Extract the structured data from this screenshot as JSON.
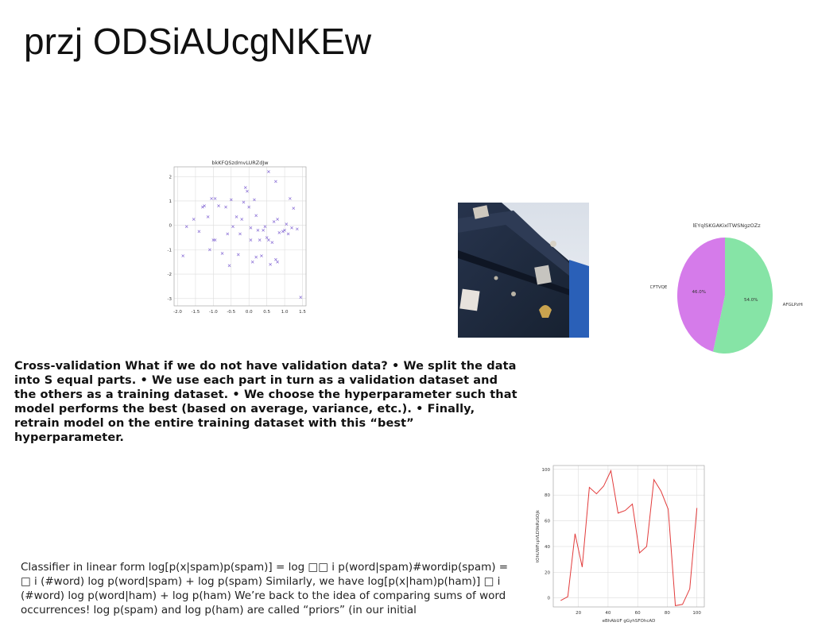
{
  "slide": {
    "title": "przj ODSiAUcgNKEw",
    "bold_paragraph": "Cross-validation What if we do not have validation data? • We split the data into S equal parts. • We use each part in turn as a validation dataset and the others as a training dataset. • We choose the hyperparameter such that model performs the best (based on average, variance, etc.). • Finally, retrain model on the entire training dataset with this “best” hyperparameter.",
    "body_paragraph": "Classifier in linear form log[p(x|spam)p(spam)] = log □□ i p(word|spam)#wordip(spam) = □ i (#word) log p(word|spam) + log p(spam) Similarly, we have log[p(x|ham)p(ham)] □ i (#word) log p(word|ham) + log p(ham) We’re back to the idea of comparing sums of word occurrences! log p(spam) and log p(ham) are called “priors” (in our initial"
  },
  "chart_data": [
    {
      "type": "scatter",
      "title": "bkKFQSzdmvLURZdJw",
      "xlim": [
        -2.1,
        1.6
      ],
      "ylim": [
        -3.3,
        2.4
      ],
      "xticks": [
        "-2.0",
        "-1.5",
        "-1.0",
        "-0.5",
        "0.0",
        "0.5",
        "1.0",
        "1.5"
      ],
      "yticks": [
        "-3",
        "-2",
        "-1",
        "0",
        "1",
        "2"
      ],
      "grid": true,
      "marker": "x",
      "color": "#8a6fd6",
      "points": [
        [
          -1.85,
          -1.25
        ],
        [
          -1.75,
          -0.05
        ],
        [
          -1.55,
          0.25
        ],
        [
          -1.4,
          -0.25
        ],
        [
          -1.3,
          0.75
        ],
        [
          -1.25,
          0.8
        ],
        [
          -1.15,
          0.35
        ],
        [
          -1.1,
          -1.0
        ],
        [
          -1.05,
          1.1
        ],
        [
          -0.95,
          1.1
        ],
        [
          -1.0,
          -0.6
        ],
        [
          -0.95,
          -0.6
        ],
        [
          -0.85,
          0.8
        ],
        [
          -0.75,
          -1.15
        ],
        [
          -0.65,
          0.75
        ],
        [
          -0.6,
          -0.35
        ],
        [
          -0.55,
          -1.65
        ],
        [
          -0.5,
          1.05
        ],
        [
          -0.45,
          -0.05
        ],
        [
          -0.35,
          0.35
        ],
        [
          -0.3,
          -1.2
        ],
        [
          -0.25,
          -0.35
        ],
        [
          -0.2,
          0.25
        ],
        [
          -0.15,
          0.95
        ],
        [
          -0.1,
          1.55
        ],
        [
          -0.05,
          1.4
        ],
        [
          0.0,
          0.75
        ],
        [
          0.05,
          -0.6
        ],
        [
          0.05,
          -0.1
        ],
        [
          0.1,
          -1.5
        ],
        [
          0.15,
          1.05
        ],
        [
          0.2,
          -1.3
        ],
        [
          0.2,
          0.4
        ],
        [
          0.25,
          -0.2
        ],
        [
          0.3,
          -0.6
        ],
        [
          0.35,
          -1.25
        ],
        [
          0.4,
          -0.2
        ],
        [
          0.45,
          -0.05
        ],
        [
          0.5,
          -0.5
        ],
        [
          0.55,
          -0.6
        ],
        [
          0.55,
          2.2
        ],
        [
          0.6,
          -1.6
        ],
        [
          0.65,
          -0.7
        ],
        [
          0.7,
          0.15
        ],
        [
          0.75,
          1.8
        ],
        [
          0.75,
          -1.4
        ],
        [
          0.8,
          -1.5
        ],
        [
          0.8,
          0.25
        ],
        [
          0.85,
          -0.3
        ],
        [
          0.95,
          -0.25
        ],
        [
          1.0,
          -0.2
        ],
        [
          1.05,
          0.05
        ],
        [
          1.1,
          -0.35
        ],
        [
          1.15,
          1.1
        ],
        [
          1.2,
          -0.1
        ],
        [
          1.25,
          0.7
        ],
        [
          1.35,
          -0.15
        ],
        [
          1.45,
          -2.95
        ]
      ]
    },
    {
      "type": "pie",
      "title": "lEYqlSKGAKixlTWSNgzOZz",
      "labels": [
        "cnCFTVQE",
        "AFGLPzHiq"
      ],
      "values": [
        46.0,
        54.0
      ],
      "pct_labels": [
        "46.0%",
        "54.0%"
      ],
      "colors": [
        "#d57bea",
        "#86e4a6"
      ]
    },
    {
      "type": "line",
      "xlabel": "eBhAbUF gGyhSFOhcAD",
      "ylabel": "tOhUWFcpVLD9kRzSOjk",
      "xlim": [
        3,
        105
      ],
      "ylim": [
        -7,
        103
      ],
      "xticks": [
        "20",
        "40",
        "60",
        "80",
        "100"
      ],
      "yticks": [
        "0",
        "20",
        "40",
        "60",
        "80",
        "100"
      ],
      "grid": true,
      "color": "#e23b3b",
      "x": [
        8,
        14,
        20,
        26,
        32,
        38,
        44,
        50,
        56,
        62,
        68,
        74,
        80,
        86,
        92,
        98,
        100
      ],
      "y": [
        -2,
        1,
        50,
        24,
        86,
        81,
        87,
        99,
        66,
        68,
        73,
        35,
        40,
        92,
        83,
        69,
        70
      ],
      "y_full": [
        -2,
        1,
        50,
        24,
        86,
        81,
        87,
        99,
        66,
        68,
        73,
        35,
        40,
        92,
        83,
        69,
        -6,
        -5,
        7,
        70
      ]
    }
  ]
}
